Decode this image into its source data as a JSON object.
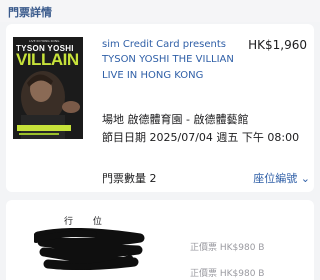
{
  "header": {
    "title": "門票詳情"
  },
  "poster": {
    "tagline": "LIVE IN HONG KONG",
    "artist": "TYSON YOSHI",
    "word": "VILLAIN"
  },
  "event": {
    "presenter": "sim Credit Card presents",
    "title": "TYSON YOSHI THE VILLIAN LIVE IN HONG KONG",
    "price": "HK$1,960",
    "venue": "場地 啟德體育園 - 啟德體藝館",
    "date": "節目日期 2025/07/04 週五 下午 08:00",
    "quantity": "門票數量 2",
    "seat_link": "座位編號"
  },
  "seats": {
    "col_row": "行",
    "col_seat": "位",
    "rows": [
      {
        "price": "正價票 HK$980 B"
      },
      {
        "price": "正價票 HK$980 B"
      }
    ]
  },
  "colors": {
    "link": "#2f5fa7",
    "poster_accent": "#c7e23a"
  }
}
